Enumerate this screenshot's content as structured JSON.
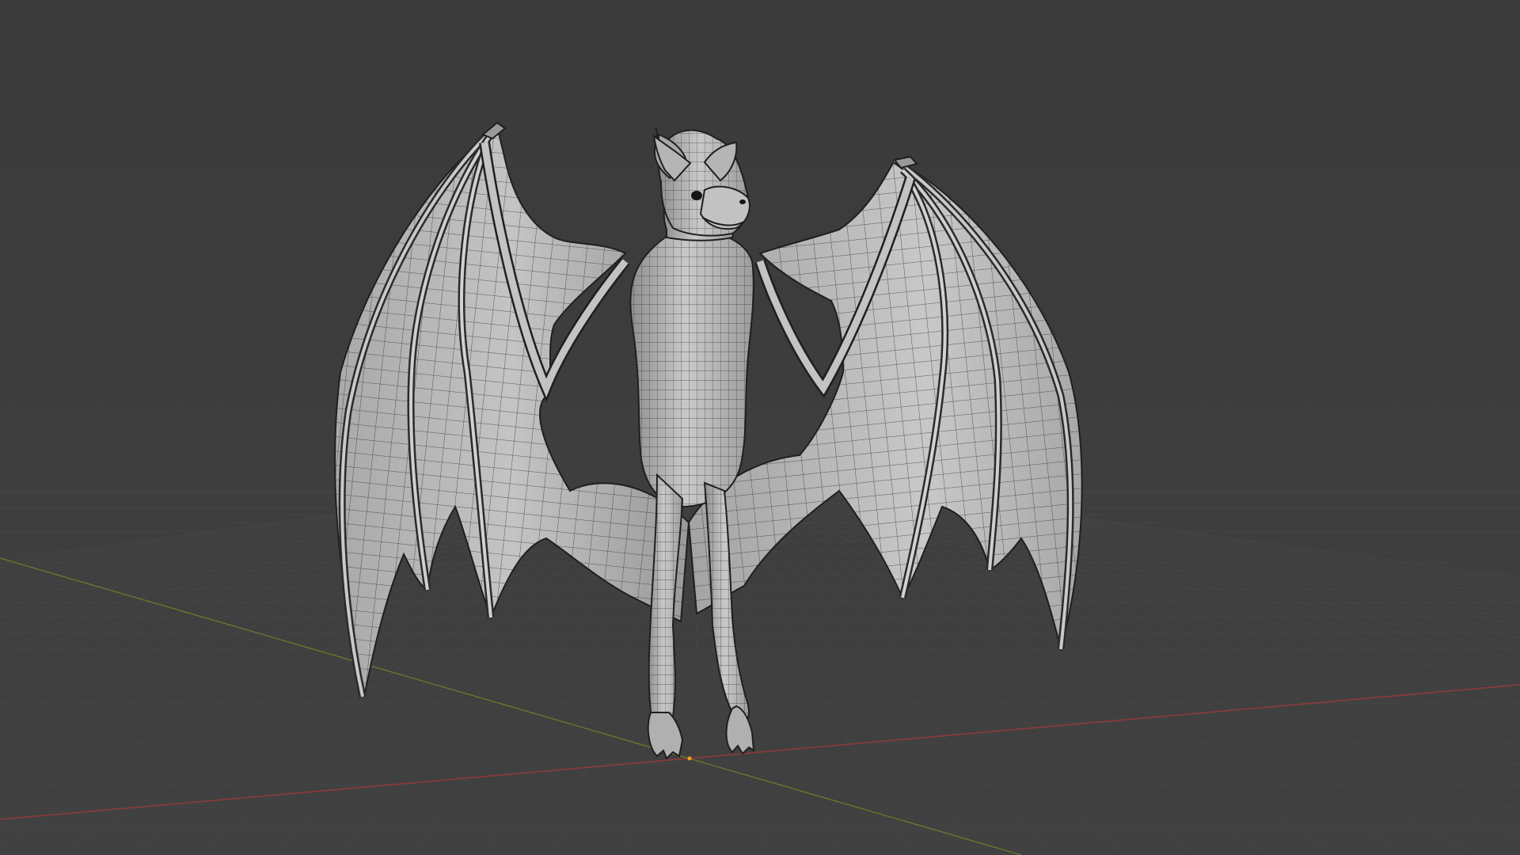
{
  "viewport": {
    "background_color": "#3d3d3d",
    "grid_color": "#464646",
    "x_axis_color": "#9a3b3b",
    "y_axis_color": "#6c8a2c",
    "mesh_fill_color": "#b9b9b9",
    "mesh_wire_color": "#1c1c1c",
    "origin_color": "#f0a020",
    "object": "bat-mesh",
    "shading": "solid-wireframe"
  }
}
